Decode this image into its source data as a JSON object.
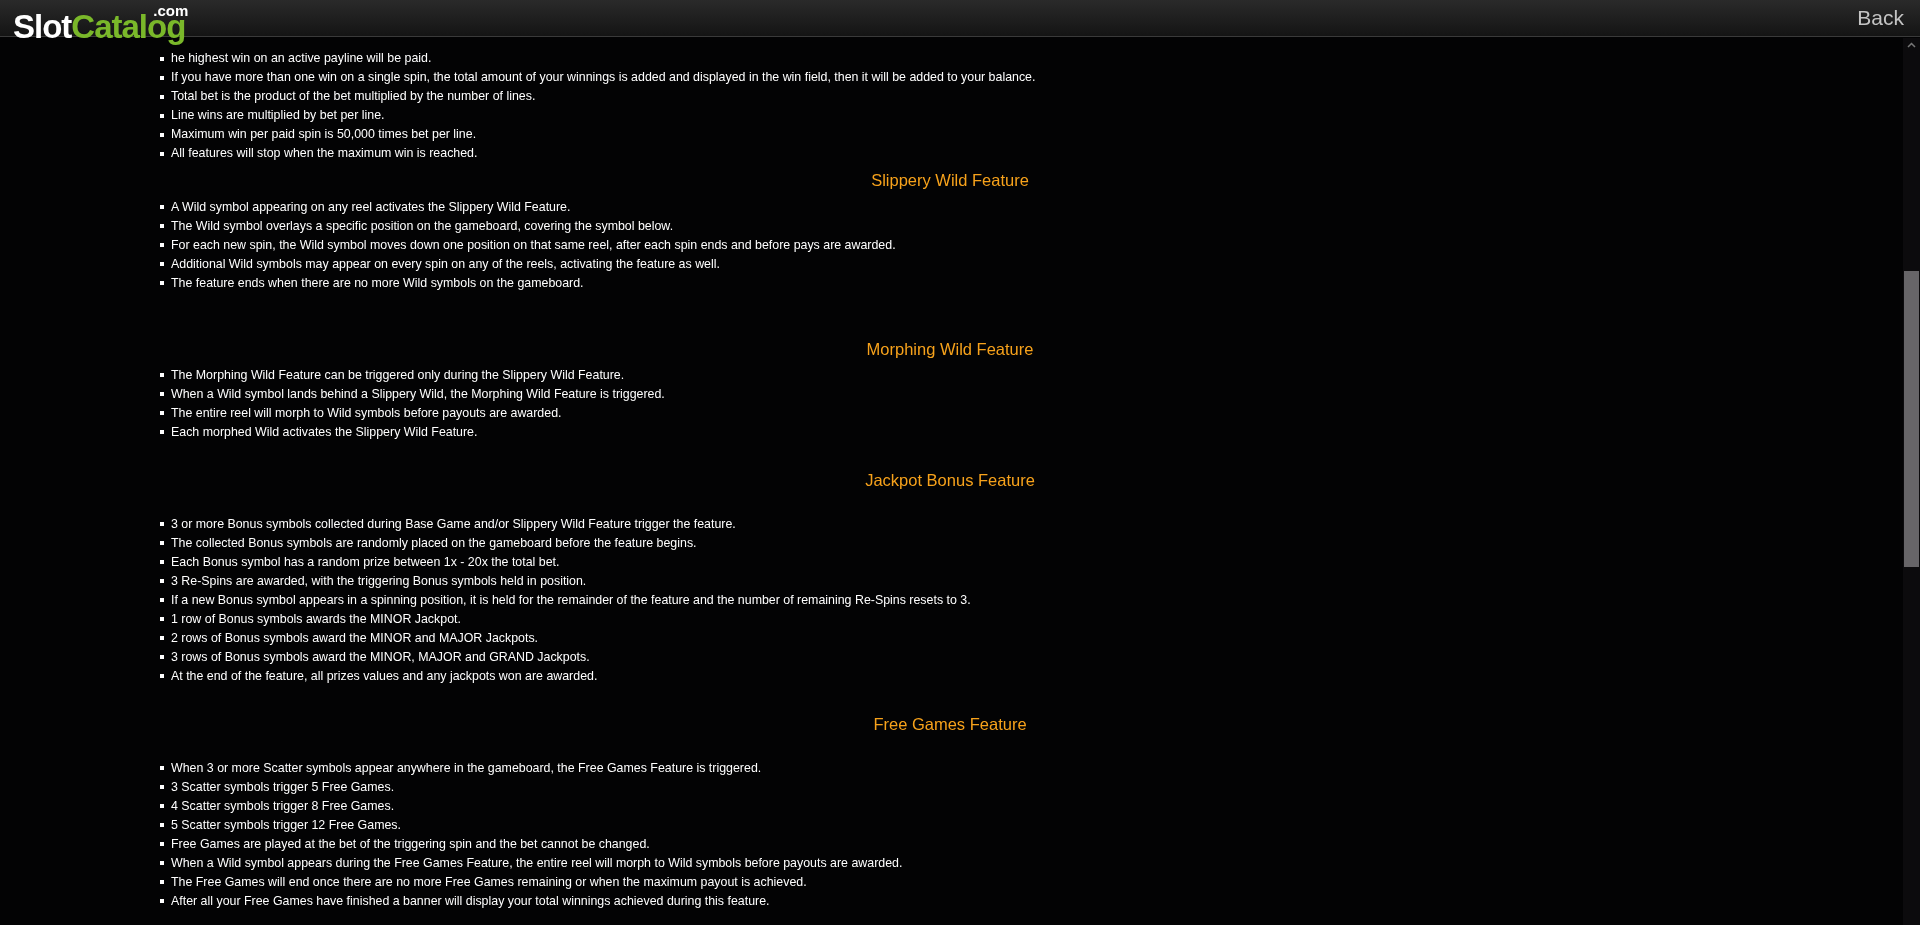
{
  "header": {
    "logo": {
      "word_1": "Slot",
      "word_2": "Catalog",
      "suffix": ".com"
    },
    "back_link": "Back"
  },
  "sections": [
    {
      "items": [
        "he highest win on an active payline will be paid.",
        "If you have more than one win on a single spin, the total amount of your winnings is added and displayed in the win field, then it will be added to your balance.",
        "Total bet is the product of the bet multiplied by the number of lines.",
        "Line wins are multiplied by bet per line.",
        "Maximum win per paid spin is 50,000 times bet per line.",
        "All features will stop when the maximum win is reached."
      ]
    },
    {
      "heading": "Slippery Wild Feature",
      "items": [
        "A Wild symbol appearing on any reel activates the Slippery Wild Feature.",
        "The Wild symbol overlays a specific position on the gameboard, covering the symbol below.",
        "For each new spin, the Wild symbol moves down one position on that same reel, after each spin ends and before pays are awarded.",
        "Additional Wild symbols may appear on every spin on any of the reels, activating the feature as well.",
        "The feature ends when there are no more Wild symbols on the gameboard."
      ]
    },
    {
      "heading": "Morphing Wild Feature",
      "items": [
        "The Morphing Wild Feature can be triggered only during the Slippery Wild Feature.",
        "When a Wild symbol lands behind a Slippery Wild, the Morphing Wild Feature is triggered.",
        "The entire reel will morph to Wild symbols before payouts are awarded.",
        "Each morphed Wild activates the Slippery Wild Feature."
      ]
    },
    {
      "heading": "Jackpot Bonus Feature",
      "items": [
        "3 or more Bonus symbols collected during Base Game and/or Slippery Wild Feature trigger the feature.",
        "The collected Bonus symbols are randomly placed on the gameboard before the feature begins.",
        "Each Bonus symbol has a random prize between 1x - 20x the total bet.",
        "3 Re-Spins are awarded, with the triggering Bonus symbols held in position.",
        "If a new Bonus symbol appears in a spinning position, it is held for the remainder of the feature and the number of remaining Re-Spins resets to 3.",
        "1 row of Bonus symbols awards the MINOR Jackpot.",
        "2 rows of Bonus symbols award the MINOR and MAJOR Jackpots.",
        "3 rows of Bonus symbols award the MINOR, MAJOR and GRAND Jackpots.",
        "At the end of the feature, all prizes values and any jackpots won are awarded."
      ]
    },
    {
      "heading": "Free Games Feature",
      "items": [
        "When 3 or more Scatter symbols appear anywhere in the gameboard, the Free Games Feature is triggered.",
        "3 Scatter symbols trigger 5 Free Games.",
        "4 Scatter symbols trigger 8 Free Games.",
        "5 Scatter symbols trigger 12 Free Games.",
        "Free Games are played at the bet of the triggering spin and the bet cannot be changed.",
        "When a Wild symbol appears during the Free Games Feature, the entire reel will morph to Wild symbols before payouts are awarded.",
        "The Free Games will end once there are no more Free Games remaining or when the maximum payout is achieved.",
        "After all your Free Games have finished a banner will display your total winnings achieved during this feature."
      ]
    }
  ]
}
